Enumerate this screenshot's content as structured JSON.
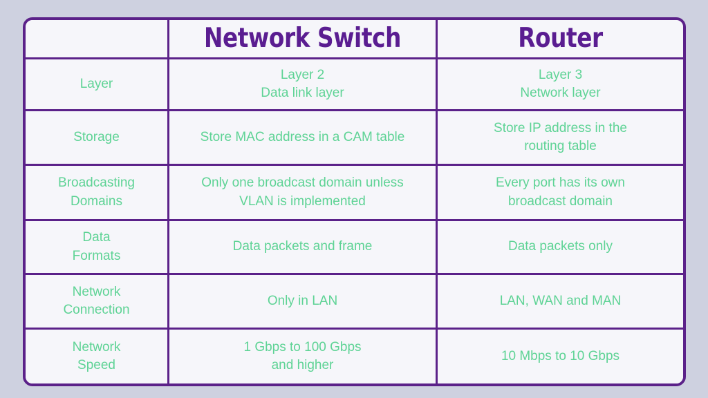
{
  "table": {
    "headers": {
      "label_column": "",
      "col1": "Network Switch",
      "col2": "Router"
    },
    "rows": [
      {
        "label": "Layer",
        "switch": "Layer 2\nData link layer",
        "router": "Layer 3\nNetwork layer"
      },
      {
        "label": "Storage",
        "switch": "Store MAC address in a CAM table",
        "router": "Store IP address in the\nrouting table"
      },
      {
        "label": "Broadcasting\nDomains",
        "switch": "Only one broadcast domain unless\nVLAN is implemented",
        "router": "Every port has its own\nbroadcast domain"
      },
      {
        "label": "Data\nFormats",
        "switch": "Data packets and frame",
        "router": "Data packets only"
      },
      {
        "label": "Network\nConnection",
        "switch": "Only in LAN",
        "router": "LAN, WAN and MAN"
      },
      {
        "label": "Network\nSpeed",
        "switch": "1 Gbps to 100 Gbps\nand higher",
        "router": "10 Mbps to 10 Gbps"
      }
    ]
  },
  "colors": {
    "page_background": "#ced1e0",
    "cell_background": "#f6f6fa",
    "border_purple": "#5b2189",
    "heading_purple": "#5a1d91",
    "body_green": "#5ed395"
  }
}
